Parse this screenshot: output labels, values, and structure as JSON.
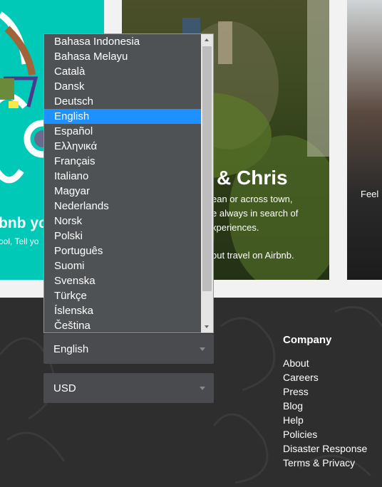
{
  "hero": {
    "left_headline": "bnb yo",
    "left_sub": "ool, Tell yo",
    "mid_headline": "& Chris",
    "mid_lines": [
      "ean or across town,",
      "e always in search of",
      "xperiences.",
      "out travel on Airbnb."
    ],
    "right_text": "Feel"
  },
  "language_dropdown": {
    "options": [
      "Bahasa Indonesia",
      "Bahasa Melayu",
      "Català",
      "Dansk",
      "Deutsch",
      "English",
      "Español",
      "Ελληνικά",
      "Français",
      "Italiano",
      "Magyar",
      "Nederlands",
      "Norsk",
      "Polski",
      "Português",
      "Suomi",
      "Svenska",
      "Türkçe",
      "Íslenska",
      "Čeština"
    ],
    "selected_index": 5,
    "selected_value": "English"
  },
  "currency_select": {
    "value": "USD"
  },
  "company": {
    "title": "Company",
    "links": [
      "About",
      "Careers",
      "Press",
      "Blog",
      "Help",
      "Policies",
      "Disaster Response",
      "Terms & Privacy"
    ]
  },
  "colors": {
    "teal": "#00c9b7",
    "footer_bg": "#2e2e2f",
    "select_bg": "#494b4e",
    "listbox_bg": "#4f5254",
    "highlight": "#1e90ff"
  }
}
